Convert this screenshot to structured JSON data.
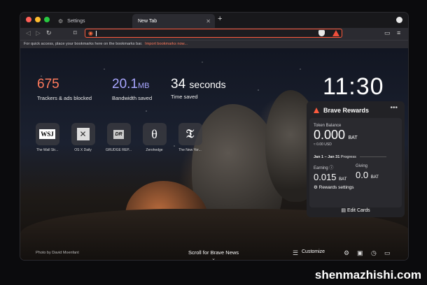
{
  "tabs": [
    {
      "label": "Settings",
      "icon": "gear-icon"
    },
    {
      "label": "New Tab",
      "icon": ""
    }
  ],
  "toolbar": {
    "address_value": ""
  },
  "bookmarks_bar": {
    "message": "For quick access, place your bookmarks here on the bookmarks bar.",
    "link": "Import bookmarks now..."
  },
  "stats": [
    {
      "value": "675",
      "unit": "",
      "label": "Trackers & ads blocked",
      "color": "#ff7a5c"
    },
    {
      "value": "20.1",
      "unit": "MB",
      "label": "Bandwidth saved",
      "color": "#a8a6ff"
    },
    {
      "value": "34",
      "unit": "seconds",
      "label": "Time saved",
      "color": "#ffffff"
    }
  ],
  "clock": "11:30",
  "top_sites": [
    {
      "name": "The Wall Str...",
      "glyph": "WSJ"
    },
    {
      "name": "OS X Daily",
      "glyph": "✕"
    },
    {
      "name": "GRUDGE REP...",
      "glyph": "DR"
    },
    {
      "name": "Zerohedge",
      "glyph": "θ"
    },
    {
      "name": "The New Yor...",
      "glyph": "𝔗"
    }
  ],
  "rewards": {
    "title": "Brave Rewards",
    "token_balance_label": "Token Balance",
    "balance": "0.000",
    "balance_currency": "BAT",
    "usd": "≈ 0.00 USD",
    "period": "Jan 1 – Jan 31",
    "progress_label": "Progress",
    "earning_label": "Earning",
    "earning_value": "0.015",
    "giving_label": "Giving",
    "giving_value": "0.0",
    "currency": "BAT",
    "settings_label": "Rewards settings",
    "edit_cards": "Edit Cards"
  },
  "bottom": {
    "photo_credit": "Photo by David Moenfant",
    "news_label": "Scroll for Brave News",
    "customize": "Customize"
  },
  "watermark": "shenmazhishi.com"
}
